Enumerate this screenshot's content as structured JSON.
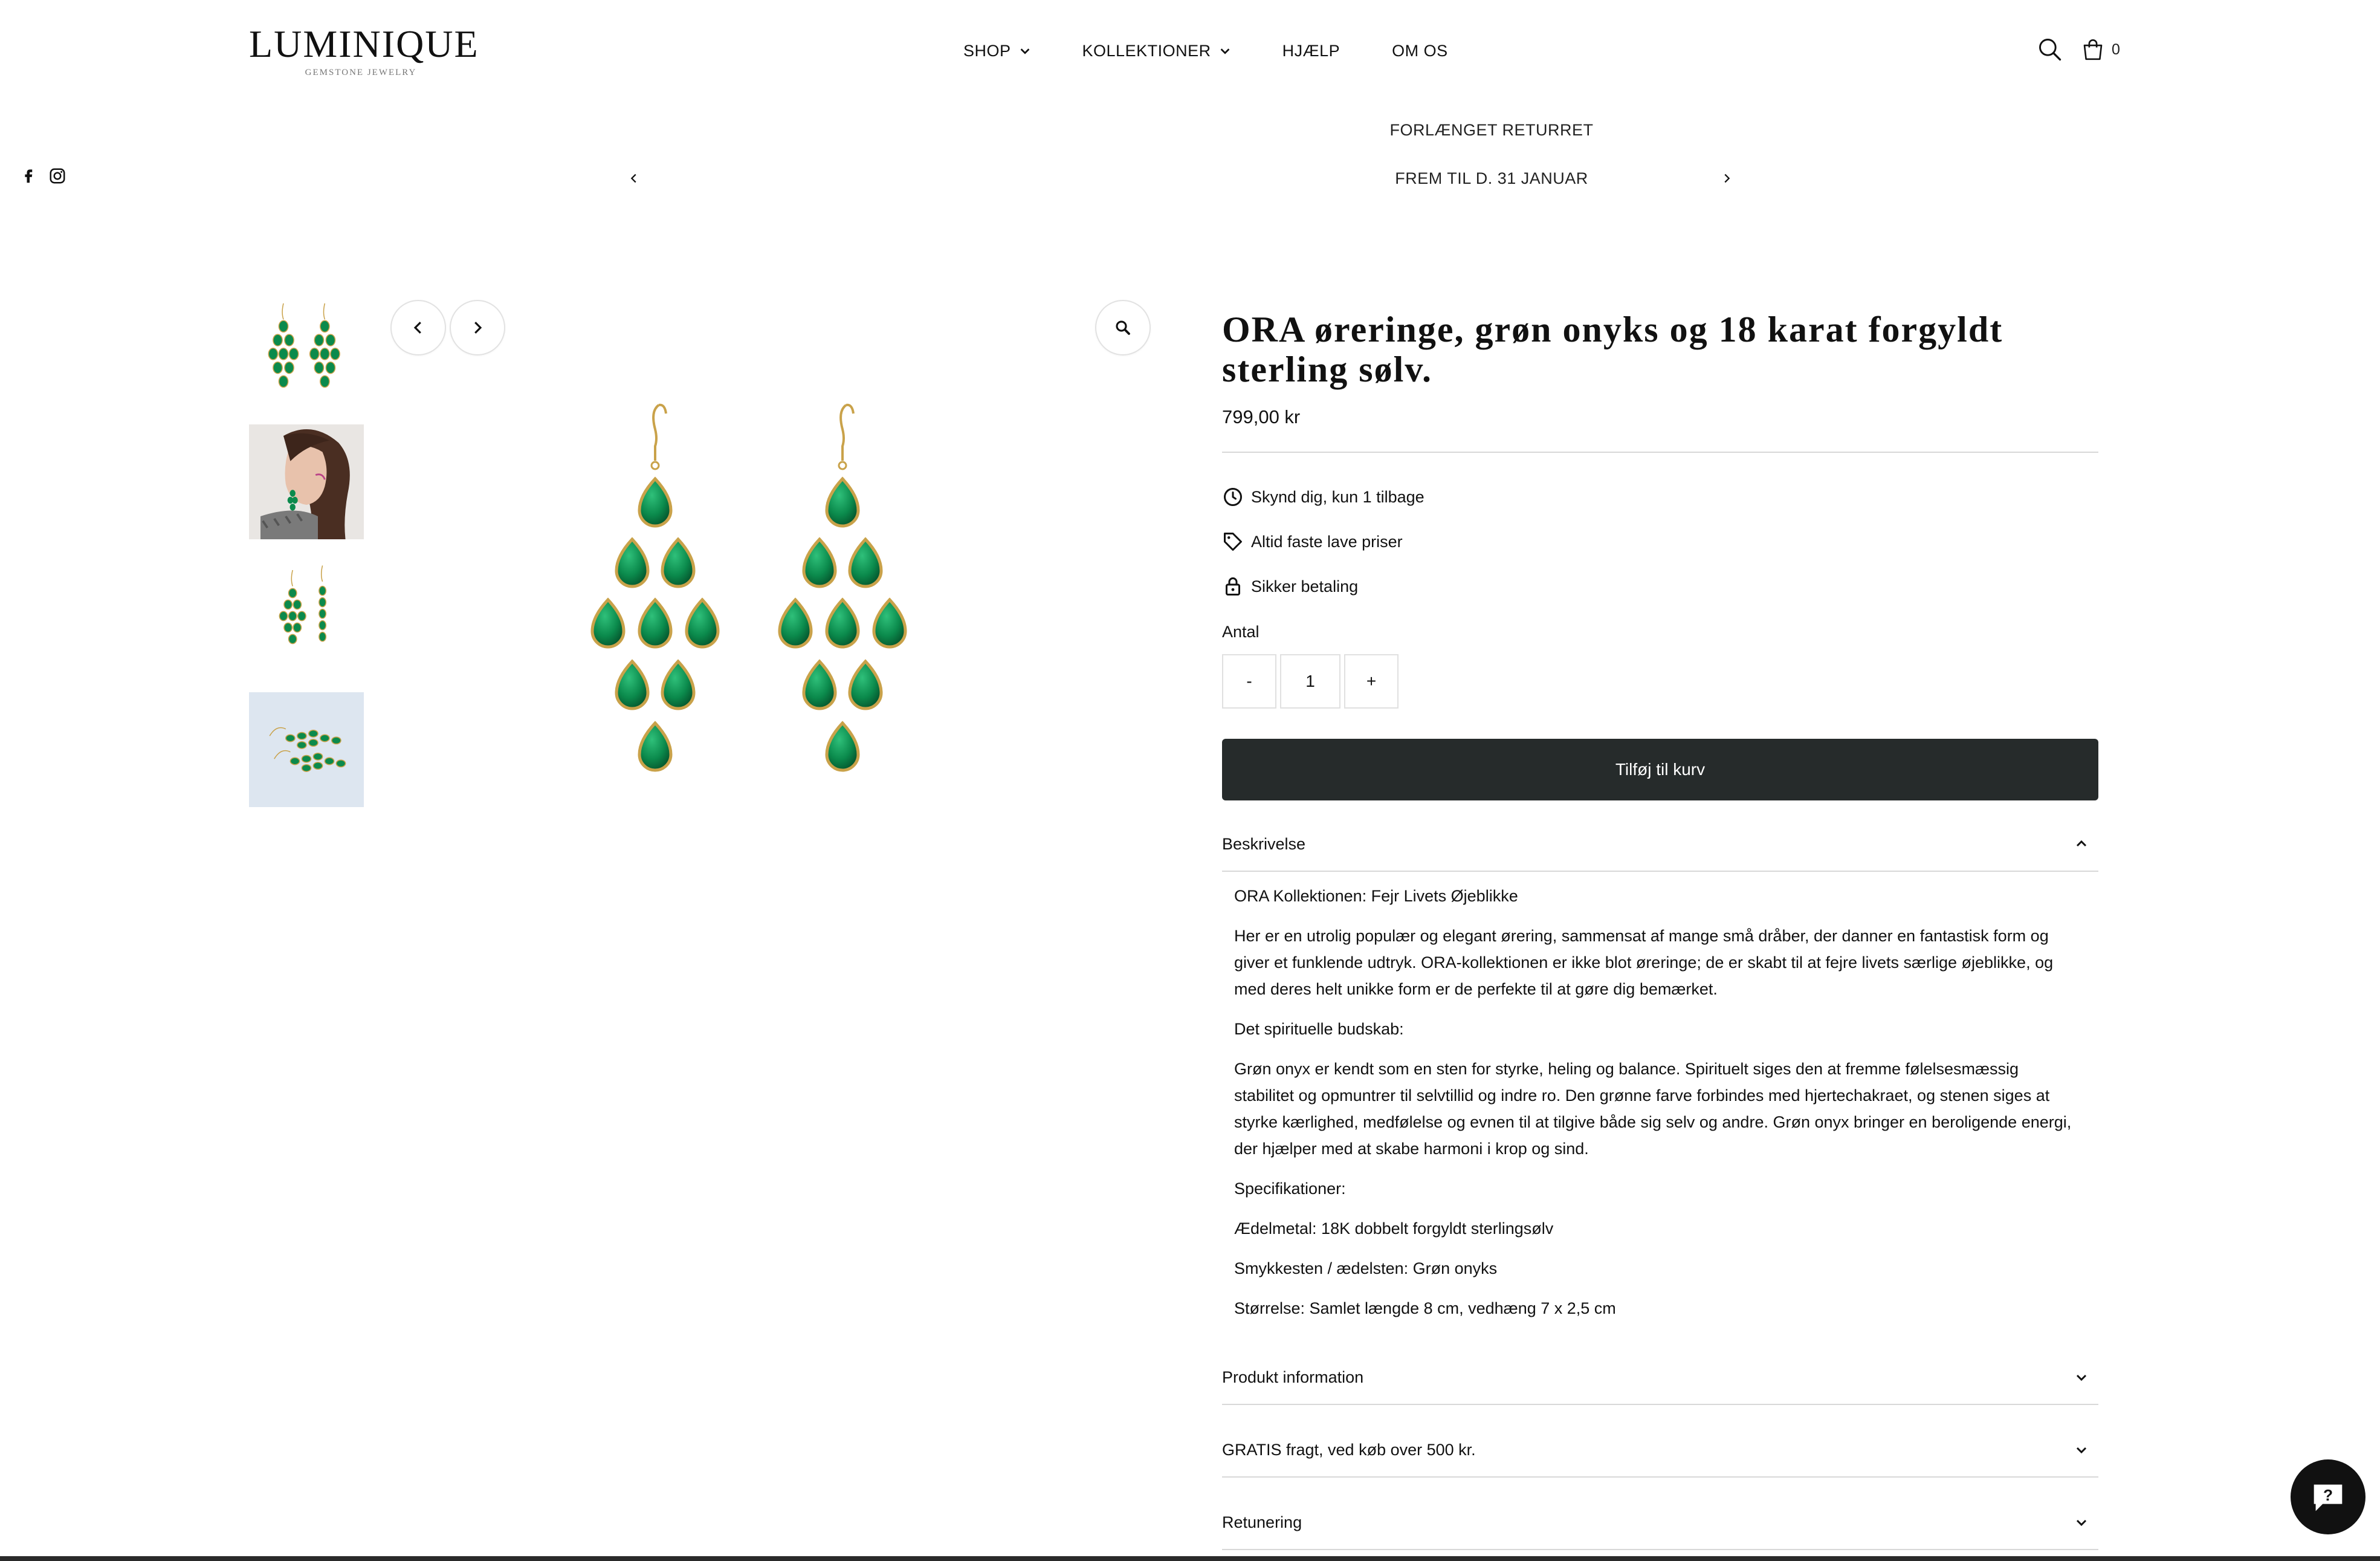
{
  "brand": {
    "name": "LUMINIQUE",
    "tagline": "GEMSTONE JEWELRY"
  },
  "nav": {
    "items": [
      {
        "label": "SHOP",
        "has_dropdown": true
      },
      {
        "label": "KOLLEKTIONER",
        "has_dropdown": true
      },
      {
        "label": "HJÆLP",
        "has_dropdown": false
      },
      {
        "label": "OM OS",
        "has_dropdown": false
      }
    ]
  },
  "header": {
    "cart_count": "0",
    "icons": [
      "search-icon",
      "shopping-bag-icon"
    ]
  },
  "social": {
    "icons": [
      "facebook-icon",
      "instagram-icon"
    ]
  },
  "announcement": {
    "line1": "FORLÆNGET RETURRET",
    "line2": "FREM TIL D. 31 JANUAR"
  },
  "gallery": {
    "thumbnails": [
      "earrings-front",
      "model-wearing",
      "earrings-side",
      "earrings-lying"
    ],
    "stone_color": "#0b8a4c",
    "metal_color": "#c9a24a"
  },
  "product": {
    "title": "ORA øreringe, grøn onyks og 18 karat forgyldt sterling sølv.",
    "price": "799,00 kr",
    "features": [
      {
        "icon": "clock-icon",
        "text": "Skynd dig, kun 1 tilbage"
      },
      {
        "icon": "tag-icon",
        "text": "Altid faste lave priser"
      },
      {
        "icon": "lock-icon",
        "text": "Sikker betaling"
      }
    ],
    "quantity_label": "Antal",
    "quantity_minus": "-",
    "quantity_value": "1",
    "quantity_plus": "+",
    "add_to_cart": "Tilføj til kurv"
  },
  "accordion": {
    "description_title": "Beskrivelse",
    "description": [
      "ORA Kollektionen: Fejr Livets Øjeblikke",
      "Her er en utrolig populær og elegant ørering, sammensat af mange små dråber, der danner en fantastisk form og giver et funklende udtryk. ORA-kollektionen er ikke blot øreringe; de er skabt til at fejre livets særlige øjeblikke, og med deres helt unikke form er de perfekte til at gøre dig bemærket.",
      "Det spirituelle budskab:",
      "Grøn onyx er kendt som en sten for styrke, heling og balance. Spirituelt siges den at fremme følelsesmæssig stabilitet og opmuntrer til selvtillid og indre ro. Den grønne farve forbindes med hjertechakraet, og stenen siges at styrke kærlighed, medfølelse og evnen til at tilgive både sig selv og andre. Grøn onyx bringer en beroligende energi, der hjælper med at skabe harmoni i krop og sind.",
      "Specifikationer:",
      "Ædelmetal: 18K dobbelt forgyldt sterlingsølv",
      "Smykkesten / ædelsten: Grøn onyks",
      "Størrelse: Samlet længde 8 cm, vedhæng 7 x 2,5 cm"
    ],
    "product_info_title": "Produkt information",
    "shipping_title": "GRATIS fragt, ved køb over 500 kr.",
    "returns_title": "Retunering"
  }
}
